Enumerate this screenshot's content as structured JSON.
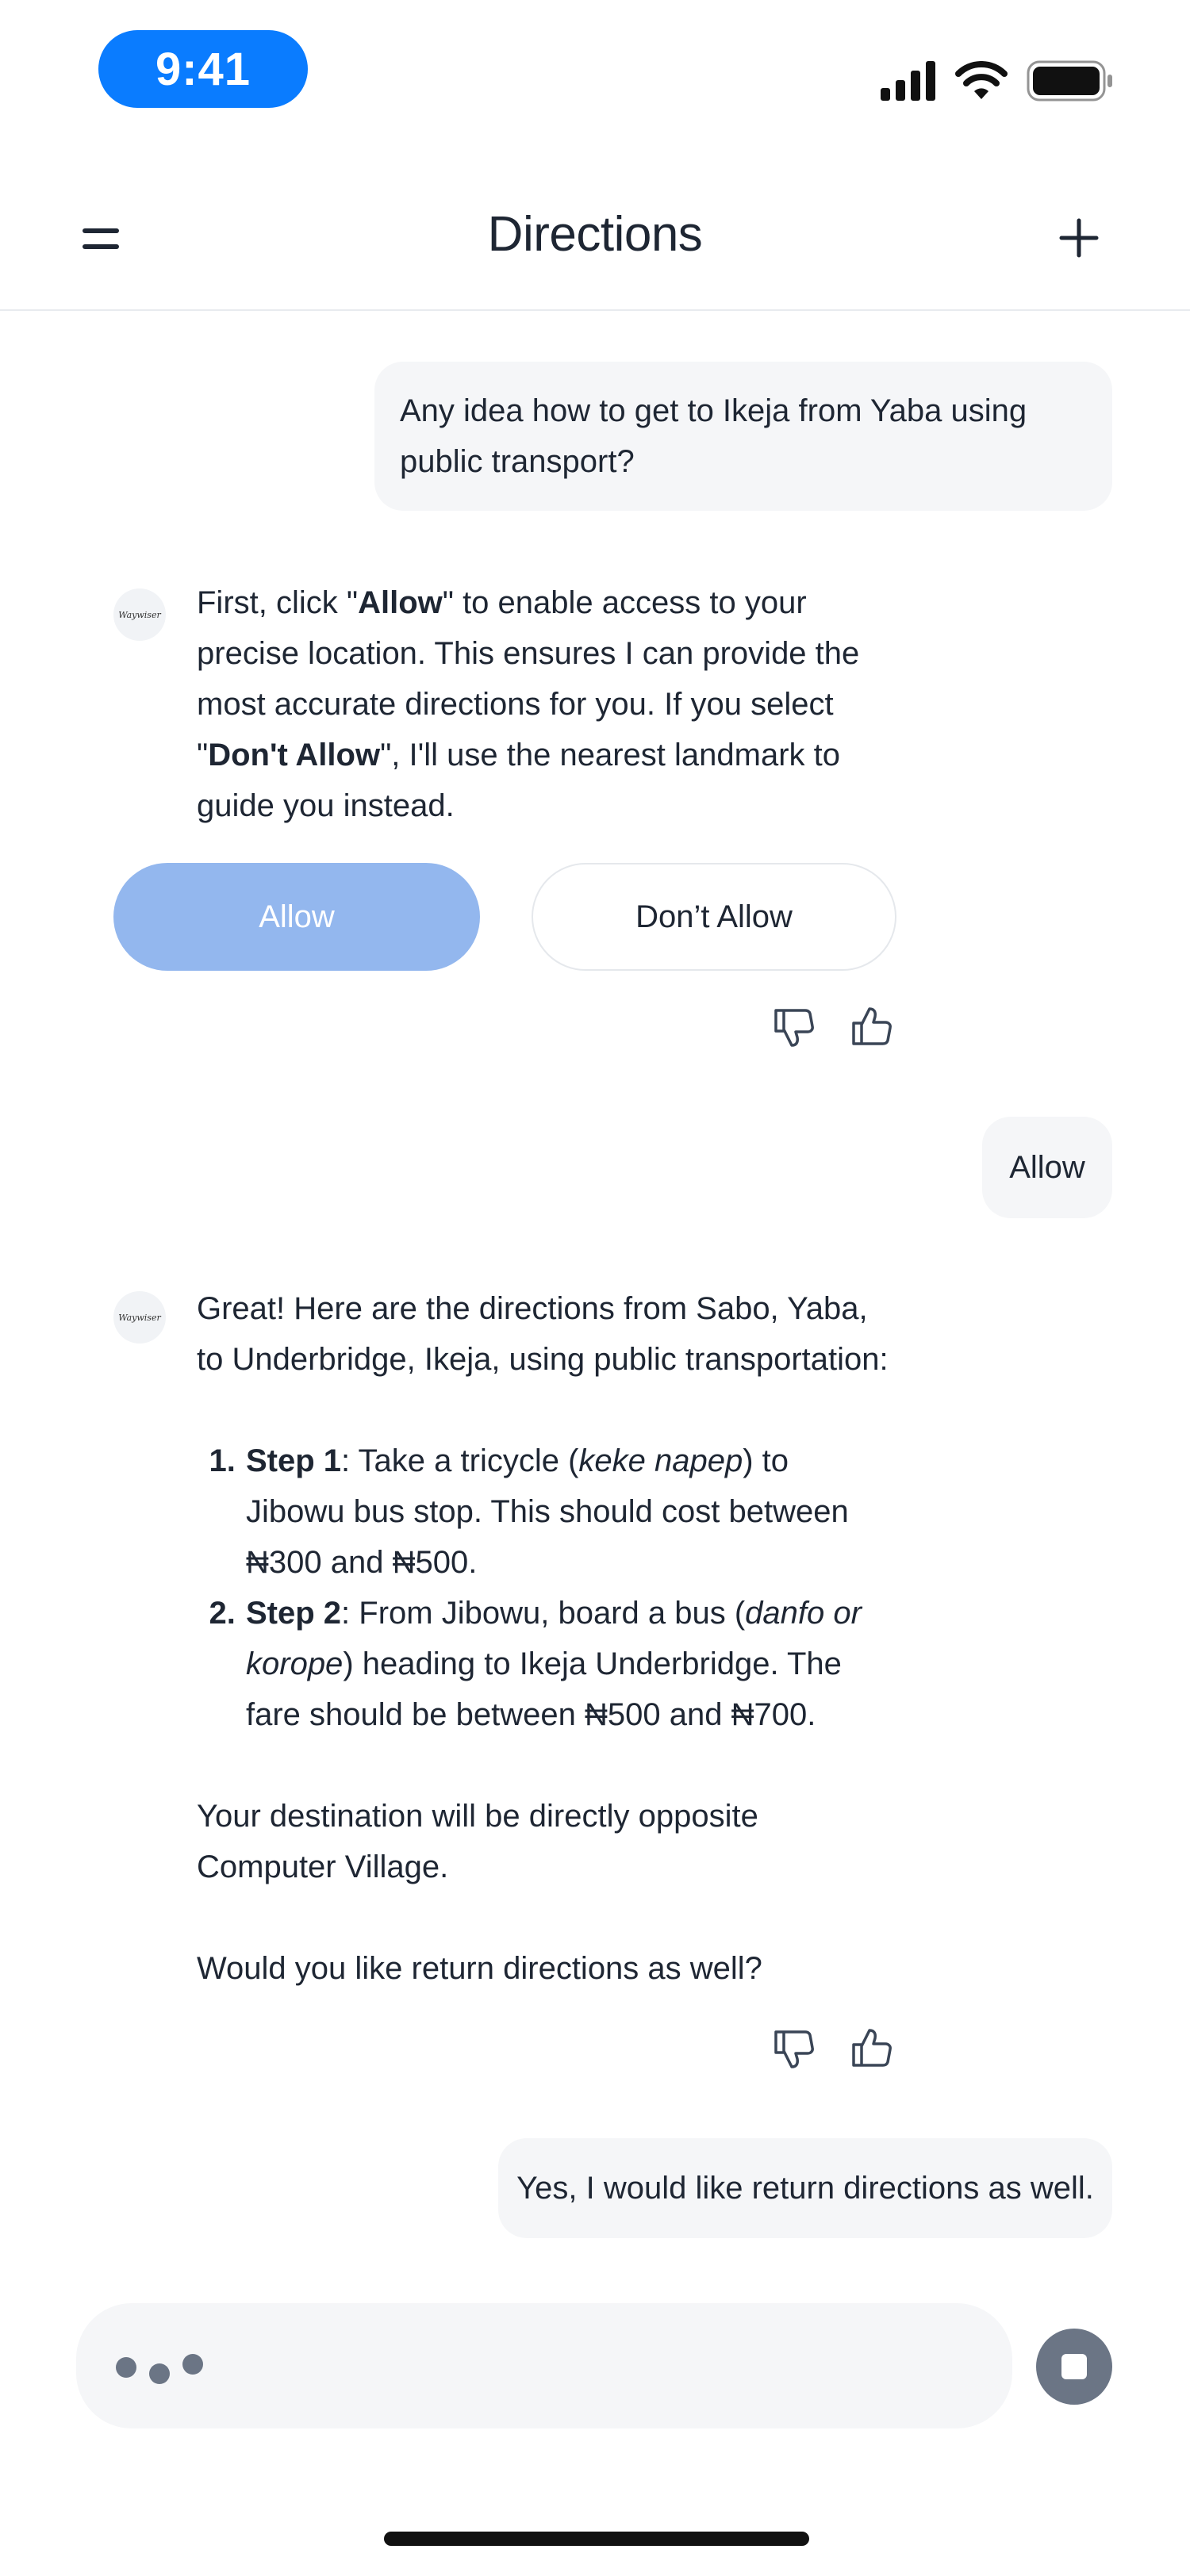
{
  "status_bar": {
    "time": "9:41"
  },
  "header": {
    "title": "Directions"
  },
  "messages": {
    "user_1": "Any idea how to get to Ikeja from Yaba using public transport?",
    "bot_1": {
      "part_a": "First, click \"",
      "allow": "Allow",
      "part_b": "\" to enable access to your precise location. This ensures I can provide the most accurate directions for you. If you select \"",
      "dont_allow": "Don't Allow",
      "part_c": "\", I'll use the nearest landmark to guide you instead."
    },
    "buttons": {
      "allow": "Allow",
      "dont_allow": "Don’t Allow"
    },
    "user_2": "Allow",
    "bot_2": {
      "intro": "Great! Here are the directions from Sabo, Yaba, to Underbridge, Ikeja, using public transportation:",
      "step1_label": "Step 1",
      "step1_a": ": Take a tricycle (",
      "step1_em": "keke napep",
      "step1_b": ") to Jibowu bus stop. This should cost between ₦300 and ₦500.",
      "step2_label": "Step 2",
      "step2_a": ": From Jibowu, board a bus (",
      "step2_em": "danfo or korope",
      "step2_b": ") heading to Ikeja Underbridge. The fare should be between ₦500 and ₦700.",
      "destination": "Your destination will be directly opposite Computer Village.",
      "question": "Would you like return directions as well?"
    },
    "user_3": "Yes, I would like return directions as well."
  },
  "avatar_text": "Waywiser",
  "icons": [
    "signal-icon",
    "wifi-icon",
    "battery-icon",
    "menu-icon",
    "plus-icon",
    "thumbs-down-icon",
    "thumbs-up-icon",
    "typing-indicator-icon",
    "stop-icon"
  ],
  "colors": {
    "time_pill": "#0a7cff",
    "allow_button": "#93b7ee",
    "bubble": "#f5f6f8",
    "stop_button": "#6b7585"
  }
}
